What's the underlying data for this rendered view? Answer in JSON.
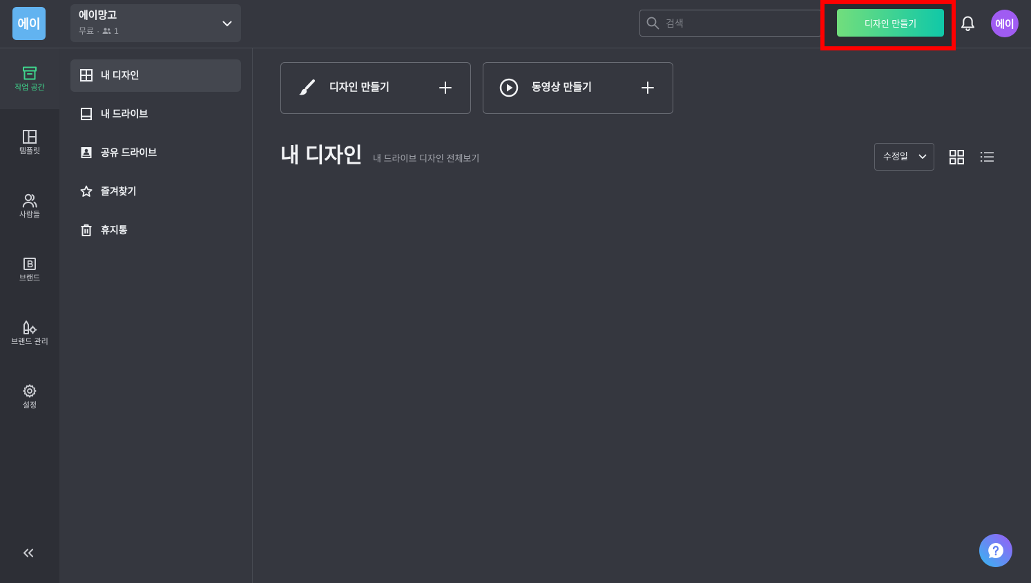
{
  "logo": {
    "text": "에이"
  },
  "workspace": {
    "name": "에이망고",
    "plan": "무료",
    "separator": "·",
    "member_count": "1",
    "member_icon": "people-icon",
    "dropdown_icon": "chevron-down-icon"
  },
  "search": {
    "placeholder": "검색",
    "icon": "search-icon"
  },
  "header": {
    "create_design_button": "디자인 만들기",
    "notification_icon": "bell-icon",
    "avatar_text": "에이"
  },
  "rail": {
    "items": [
      {
        "label": "작업 공간",
        "icon": "archive-icon",
        "active": true
      },
      {
        "label": "템플릿",
        "icon": "template-layout-icon",
        "active": false
      },
      {
        "label": "사람들",
        "icon": "people-icon",
        "active": false
      },
      {
        "label": "브랜드",
        "icon": "brand-b-icon",
        "active": false
      },
      {
        "label": "브랜드 관리",
        "icon": "brand-kit-icon",
        "active": false
      },
      {
        "label": "설정",
        "icon": "gear-icon",
        "active": false
      }
    ],
    "collapse_icon": "double-chevron-left-icon"
  },
  "sidebar": {
    "items": [
      {
        "label": "내 디자인",
        "icon": "grid-layout-icon",
        "active": true
      },
      {
        "label": "내 드라이브",
        "icon": "drive-icon",
        "active": false
      },
      {
        "label": "공유 드라이브",
        "icon": "shared-drive-icon",
        "active": false
      },
      {
        "label": "즐겨찾기",
        "icon": "star-icon",
        "active": false
      },
      {
        "label": "휴지통",
        "icon": "trash-icon",
        "active": false
      }
    ]
  },
  "main": {
    "create_cards": [
      {
        "label": "디자인 만들기",
        "icon": "brush-icon",
        "action_icon": "plus-icon"
      },
      {
        "label": "동영상 만들기",
        "icon": "play-circle-icon",
        "action_icon": "plus-icon"
      }
    ],
    "title": "내 디자인",
    "subtitle": "내 드라이브 디자인 전체보기",
    "sort": {
      "selected": "수정일"
    },
    "view_modes": [
      {
        "icon": "grid-view-icon",
        "active": true
      },
      {
        "icon": "list-view-icon",
        "active": false
      }
    ]
  },
  "help": {
    "icon": "help-chat-icon"
  },
  "colors": {
    "background": "#35373f",
    "accent_green": "#3fd58c",
    "button_gradient_start": "#72de7c",
    "button_gradient_end": "#10c8a8",
    "logo": "#62b3f0",
    "avatar": "#a05cf2",
    "highlight_box": "#ff0000"
  }
}
